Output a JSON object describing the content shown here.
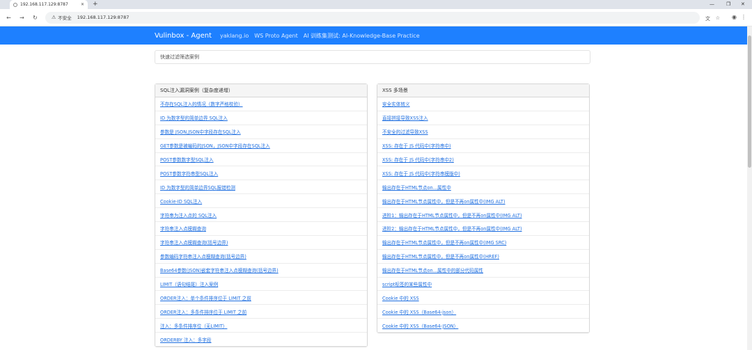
{
  "browser": {
    "tab_title": "192.168.117.129:8787",
    "address": "192.168.117.129:8787",
    "insecure_label": "不安全"
  },
  "navbar": {
    "brand": "Vulinbox - Agent",
    "links": [
      "yaklang.io",
      "WS Proto Agent",
      "AI 训练集测试: AI-Knowledge-Base Practice"
    ]
  },
  "search": {
    "placeholder": "快速过滤筛选案例"
  },
  "sql_panel": {
    "title": "SQL注入漏洞案例（复杂度递增）",
    "items": [
      "不存在SQL注入的情况（数字严格校验）",
      "ID 为数字型的简单边界 SQL注入",
      "参数是 JSON,JSON中字段存在SQL注入",
      "GET参数是被编码的JSON，JSON中字段存在SQL注入",
      "POST参数数字型SQL注入",
      "POST参数字符串型SQL注入",
      "ID 为数字型的简单边界SQL报错检测",
      "Cookie-ID SQL注入",
      "字符串为注入点的 SQL注入",
      "字符串注入点模糊查询",
      "字符串注入点模糊查询(括号边界)",
      "参数编码字符串注入点模糊查询(括号边界)",
      "Base64参数(JSON)嵌套字符串注入点模糊查询(括号边界)",
      "LIMIT（语句结尾）注入案例",
      "ORDER注入：单个条件排序位于 LIMIT 之前",
      "ORDER注入：多条件排序位于 LIMIT 之前",
      "注入：多条件排序位（无LIMIT）",
      "ORDERBY 注入：多字段"
    ]
  },
  "xss_panel": {
    "title": "XSS 多场景",
    "items": [
      "安全实体转义",
      "直接拼接导致XSS注入",
      "不安全的过滤导致XSS",
      "XSS: 存在于 JS 代码中(字符串中)",
      "XSS: 存在于 JS 代码中(字符串中2)",
      "XSS: 存在于 JS 代码中(字符串模版中)",
      "输出存在于HTML节点on...属性中",
      "输出存在于HTML节点属性中，但是不再on属性中(IMG ALT)",
      "进阶1：输出存在于HTML节点属性中，但是不再on属性中(IMG ALT)",
      "进阶2：输出存在于HTML节点属性中，但是不再on属性中(IMG ALT)",
      "输出存在于HTML节点属性中，但是不再on属性中(IMG SRC)",
      "输出存在于HTML节点属性中，但是不再on属性中(HREF)",
      "输出存在于HTML节点on...属性中的部分代码属性",
      "script标签的某些属性中",
      "Cookie 中的 XSS",
      "Cookie 中的 XSS（Base64-json）",
      "Cookie 中的 XSS（Base64-JSON）"
    ]
  }
}
